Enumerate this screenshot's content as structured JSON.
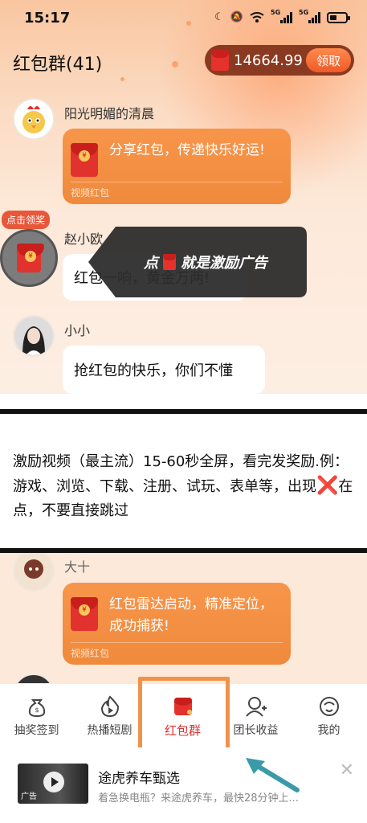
{
  "status_bar": {
    "time": "15:17",
    "signal_1": "5G",
    "signal_2": "5G"
  },
  "header": {
    "title": "红包群(41)",
    "balance": "14664.99",
    "claim_label": "领取"
  },
  "messages": [
    {
      "sender": "阳光明媚的清晨",
      "card_text": "分享红包，传递快乐好运!",
      "card_footer": "视频红包"
    },
    {
      "sender": "赵小欧",
      "claim_badge": "点击领奖",
      "bubble_text": "红包一响，黄金万两!"
    },
    {
      "sender": "小小",
      "bubble_text": "抢红包的快乐，你们不懂"
    }
  ],
  "tooltip": {
    "prefix": "点",
    "suffix": "就是激励广告"
  },
  "note": {
    "text_before": "激励视频（最主流）15-60秒全屏，看完发奖励.例：游戏、浏览、下载、注册、试玩、表单等，出现",
    "x_mark": "❌",
    "text_after": "在点，不要直接跳过"
  },
  "lower_messages": [
    {
      "sender_partial": "大十",
      "card_text": "红包雷达启动，精准定位，成功捕获!",
      "card_footer": "视频红包"
    }
  ],
  "tabs": [
    {
      "label": "抽奖签到",
      "icon": "money-bag-icon"
    },
    {
      "label": "热播短剧",
      "icon": "play-video-icon"
    },
    {
      "label": "红包群",
      "icon": "red-envelope-icon",
      "active": true
    },
    {
      "label": "团长收益",
      "icon": "user-add-icon"
    },
    {
      "label": "我的",
      "icon": "profile-icon"
    }
  ],
  "ad": {
    "thumb_tag": "广告",
    "title": "途虎养车甄选",
    "desc": "着急换电瓶？来途虎养车，最快28分钟上..."
  },
  "colors": {
    "accent": "#f08a3c",
    "active_tab": "#e0302c",
    "highlight_box": "#f0924a",
    "arrow": "#3a9aa8"
  }
}
